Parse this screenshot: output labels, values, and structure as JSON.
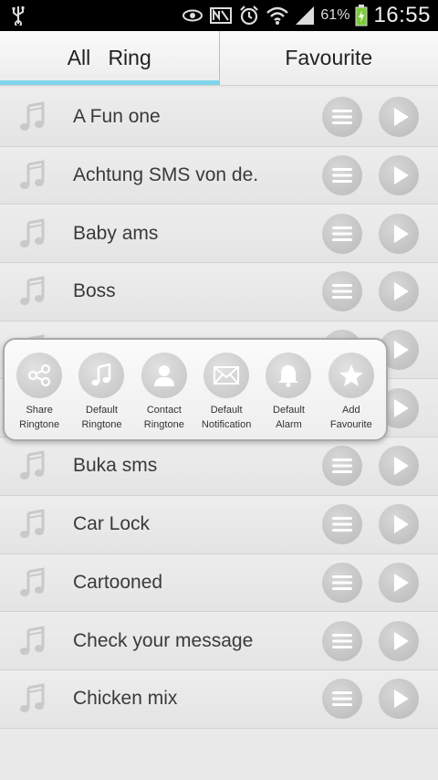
{
  "status_bar": {
    "battery_percent": "61%",
    "time": "16:55",
    "icons": [
      "usb-icon",
      "eye-icon",
      "nfc-icon",
      "alarm-icon",
      "wifi-icon",
      "signal-icon",
      "battery-charging-icon"
    ]
  },
  "tabs": [
    {
      "label": "All   Ring",
      "active": true
    },
    {
      "label": "Favourite",
      "active": false
    }
  ],
  "ringtones": [
    {
      "title": "A Fun one"
    },
    {
      "title": "Achtung SMS von de."
    },
    {
      "title": "Baby ams"
    },
    {
      "title": "Boss"
    },
    {
      "title": ""
    },
    {
      "title": ""
    },
    {
      "title": "Buka sms"
    },
    {
      "title": "Car Lock"
    },
    {
      "title": "Cartooned"
    },
    {
      "title": "Check your message"
    },
    {
      "title": "Chicken mix"
    }
  ],
  "popup": {
    "items": [
      {
        "label": "Share\nRingtone",
        "icon": "share-icon"
      },
      {
        "label": "Default\nRingtone",
        "icon": "music-note-icon"
      },
      {
        "label": "Contact\nRingtone",
        "icon": "person-icon"
      },
      {
        "label": "Default\nNotification",
        "icon": "envelope-icon"
      },
      {
        "label": "Default\nAlarm",
        "icon": "bell-icon"
      },
      {
        "label": "Add\nFavourite",
        "icon": "star-icon"
      }
    ]
  },
  "colors": {
    "tab_indicator": "#7fd6ea",
    "background": "#e9e9e9",
    "button_gray": "#c4c4c4"
  }
}
